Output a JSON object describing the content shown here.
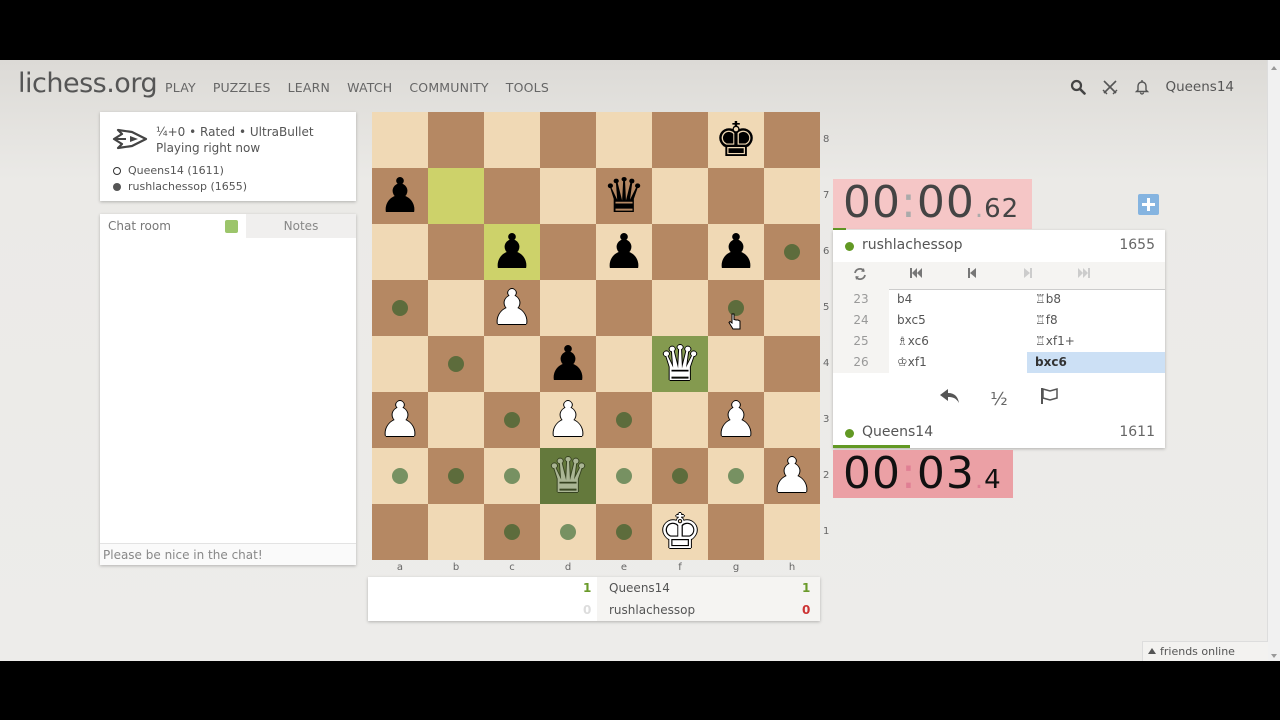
{
  "header": {
    "logo_main": "lichess",
    "logo_tld": ".org",
    "nav": [
      "PLAY",
      "PUZZLES",
      "LEARN",
      "WATCH",
      "COMMUNITY",
      "TOOLS"
    ],
    "username": "Queens14"
  },
  "game_info": {
    "line1": "¼+0 • Rated • UltraBullet",
    "line2": "Playing right now",
    "white_player": "Queens14 (1611)",
    "black_player": "rushlachessop (1655)"
  },
  "chat": {
    "tab_chat": "Chat room",
    "tab_notes": "Notes",
    "placeholder": "Please be nice in the chat!"
  },
  "board": {
    "files": [
      "a",
      "b",
      "c",
      "d",
      "e",
      "f",
      "g",
      "h"
    ],
    "ranks": [
      "8",
      "7",
      "6",
      "5",
      "4",
      "3",
      "2",
      "1"
    ],
    "pieces": [
      {
        "square": "g8",
        "glyph": "♚",
        "color": "black",
        "name": "black-king"
      },
      {
        "square": "a7",
        "glyph": "♟",
        "color": "black",
        "name": "black-pawn"
      },
      {
        "square": "e7",
        "glyph": "♛",
        "color": "black",
        "name": "black-queen"
      },
      {
        "square": "c6",
        "glyph": "♟",
        "color": "black",
        "name": "black-pawn"
      },
      {
        "square": "e6",
        "glyph": "♟",
        "color": "black",
        "name": "black-pawn"
      },
      {
        "square": "g6",
        "glyph": "♟",
        "color": "black",
        "name": "black-pawn"
      },
      {
        "square": "c5",
        "glyph": "♟",
        "color": "white",
        "name": "white-pawn"
      },
      {
        "square": "d4",
        "glyph": "♟",
        "color": "black",
        "name": "black-pawn"
      },
      {
        "square": "f4",
        "glyph": "♛",
        "color": "white",
        "name": "white-queen"
      },
      {
        "square": "a3",
        "glyph": "♟",
        "color": "white",
        "name": "white-pawn"
      },
      {
        "square": "d3",
        "glyph": "♟",
        "color": "white",
        "name": "white-pawn"
      },
      {
        "square": "g3",
        "glyph": "♟",
        "color": "white",
        "name": "white-pawn"
      },
      {
        "square": "h2",
        "glyph": "♟",
        "color": "white",
        "name": "white-pawn"
      },
      {
        "square": "f1",
        "glyph": "♚",
        "color": "white",
        "name": "white-king"
      },
      {
        "square": "d2",
        "glyph": "♛",
        "color": "white",
        "name": "white-queen-ghost",
        "ghost": true
      }
    ],
    "last_move": [
      "b7",
      "c6"
    ],
    "selected": [
      "f4",
      "d2"
    ],
    "move_dots": [
      "h6",
      "a5",
      "g5",
      "b4",
      "c3",
      "e3",
      "a2",
      "b2",
      "c2",
      "e2",
      "f2",
      "g2",
      "c1",
      "d1",
      "e1"
    ]
  },
  "score": {
    "white_name": "Queens14",
    "black_name": "rushlachessop",
    "left_white": "1",
    "left_black": "0",
    "right_white": "1",
    "right_black": "0"
  },
  "clocks": {
    "top": {
      "min": "00",
      "sec": "00",
      "frac": "62"
    },
    "bottom": {
      "min": "00",
      "sec": "03",
      "frac": "4"
    }
  },
  "players": {
    "top": {
      "name": "rushlachessop",
      "rating": "1655"
    },
    "bottom": {
      "name": "Queens14",
      "rating": "1611"
    }
  },
  "moves": [
    {
      "n": "23",
      "white": "b4",
      "black": "♖b8"
    },
    {
      "n": "24",
      "white": "bxc5",
      "black": "♖f8"
    },
    {
      "n": "25",
      "white": "♗xc6",
      "black": "♖xf1+"
    },
    {
      "n": "26",
      "white": "♔xf1",
      "black": "bxc6"
    }
  ],
  "actions": {
    "takeback": "↶",
    "draw": "½",
    "resign": "⚐"
  },
  "footer": {
    "friends": "friends online"
  }
}
